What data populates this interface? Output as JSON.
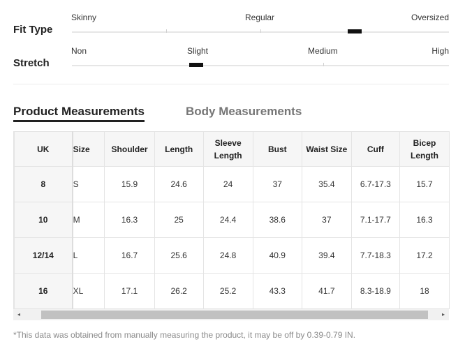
{
  "fit_type": {
    "label": "Fit Type",
    "ticks": [
      "Skinny",
      "Regular",
      "Oversized"
    ],
    "level_fraction": 0.75
  },
  "stretch": {
    "label": "Stretch",
    "ticks": [
      "Non",
      "Slight",
      "Medium",
      "High"
    ],
    "level_fraction": 0.33
  },
  "tabs": {
    "product": "Product Measurements",
    "body": "Body Measurements",
    "active": "product"
  },
  "table": {
    "headers": {
      "uk": "UK",
      "size": "Size",
      "shoulder": "Shoulder",
      "length": "Length",
      "sleeve_length": "Sleeve Length",
      "bust": "Bust",
      "waist_size": "Waist Size",
      "cuff": "Cuff",
      "bicep_length": "Bicep Length"
    },
    "rows": [
      {
        "uk": "8",
        "size": "S",
        "shoulder": "15.9",
        "length": "24.6",
        "sleeve_length": "24",
        "bust": "37",
        "waist_size": "35.4",
        "cuff": "6.7-17.3",
        "bicep_length": "15.7"
      },
      {
        "uk": "10",
        "size": "M",
        "shoulder": "16.3",
        "length": "25",
        "sleeve_length": "24.4",
        "bust": "38.6",
        "waist_size": "37",
        "cuff": "7.1-17.7",
        "bicep_length": "16.3"
      },
      {
        "uk": "12/14",
        "size": "L",
        "shoulder": "16.7",
        "length": "25.6",
        "sleeve_length": "24.8",
        "bust": "40.9",
        "waist_size": "39.4",
        "cuff": "7.7-18.3",
        "bicep_length": "17.2"
      },
      {
        "uk": "16",
        "size": "XL",
        "shoulder": "17.1",
        "length": "26.2",
        "sleeve_length": "25.2",
        "bust": "43.3",
        "waist_size": "41.7",
        "cuff": "8.3-18.9",
        "bicep_length": "18"
      }
    ]
  },
  "scrollbar": {
    "left_arrow": "◂",
    "right_arrow": "▸"
  },
  "note": "*This data was obtained from manually measuring the product, it may be off by 0.39-0.79 IN."
}
